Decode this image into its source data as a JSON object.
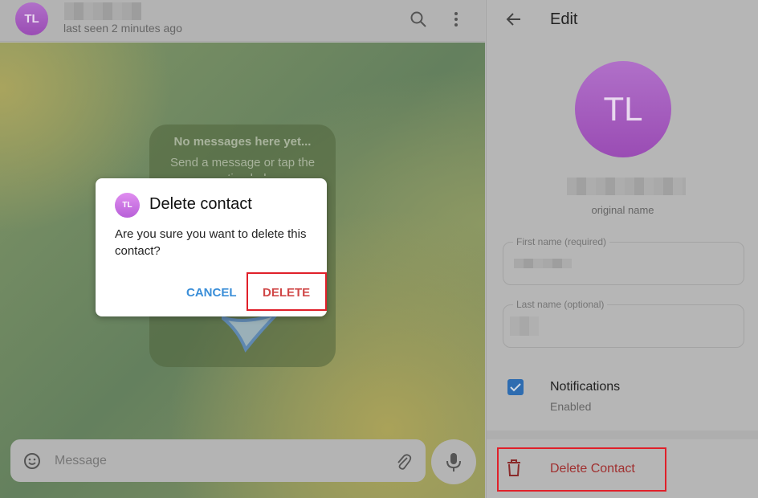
{
  "chat": {
    "avatar_initials": "TL",
    "status": "last seen 2 minutes ago",
    "empty_title": "No messages here yet...",
    "empty_text": "Send a message or tap the greeting below",
    "message_placeholder": "Message"
  },
  "dialog": {
    "avatar_initials": "TL",
    "title": "Delete contact",
    "body": "Are you sure you want to delete this contact?",
    "cancel": "CANCEL",
    "delete": "DELETE"
  },
  "edit": {
    "title": "Edit",
    "avatar_initials": "TL",
    "name_caption": "original name",
    "first_name_label": "First name (required)",
    "last_name_label": "Last name (optional)",
    "notifications_label": "Notifications",
    "notifications_status": "Enabled",
    "notifications_enabled": true,
    "delete_contact": "Delete Contact"
  },
  "colors": {
    "accent": "#3a7bc8",
    "danger": "#d03a3a",
    "avatar": "#a855c4"
  }
}
